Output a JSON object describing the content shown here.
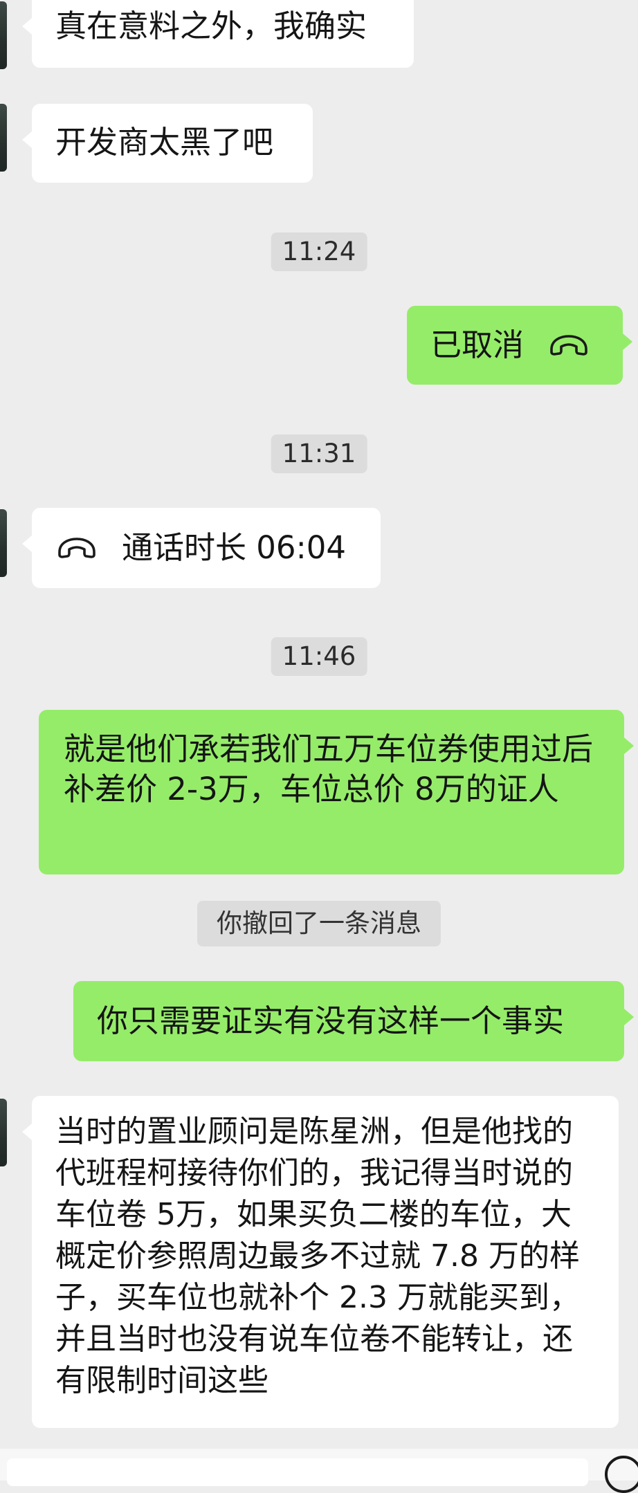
{
  "messages": {
    "m1": "真在意料之外，我确实",
    "m2": "开发商太黑了吧",
    "t1": "11:24",
    "m3_text": "已取消",
    "m3_icon": "phone-hangup-icon",
    "t2": "11:31",
    "m4_text": "通话时长 06:04",
    "m4_icon": "phone-hangup-icon",
    "t3": "11:46",
    "m5": "就是他们承若我们五万车位券使用过后补差价 2-3万，车位总价 8万的证人",
    "sys1": "你撤回了一条消息",
    "m6": "你只需要证实有没有这样一个事实",
    "m7": "当时的置业顾问是陈星洲，但是他找的代班程柯接待你们的，我记得当时说的车位卷 5万，如果买负二楼的车位，大概定价参照周边最多不过就 7.8 万的样子，买车位也就补个 2.3 万就能买到，并且当时也没有说车位卷不能转让，还有限制时间这些"
  },
  "colors": {
    "background": "#ededed",
    "incoming_bubble": "#ffffff",
    "outgoing_bubble": "#95ec69",
    "timestamp_bg": "#dcdcdc"
  }
}
